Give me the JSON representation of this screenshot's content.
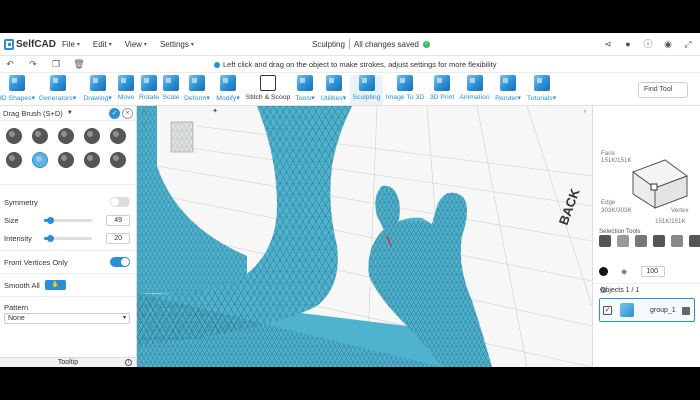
{
  "app": {
    "name": "SelfCAD",
    "mode": "Sculpting",
    "save_status": "All changes saved"
  },
  "menu": [
    {
      "label": "File"
    },
    {
      "label": "Edit"
    },
    {
      "label": "View"
    },
    {
      "label": "Settings"
    }
  ],
  "hint": "Left click and drag on the object to make strokes, adjust settings for more flexibility",
  "toolbar": {
    "tools": [
      {
        "label": "3D Shapes",
        "caret": true
      },
      {
        "label": "Generators",
        "caret": true
      },
      {
        "label": "Drawing",
        "caret": true
      },
      {
        "label": "Move",
        "caret": false
      },
      {
        "label": "Rotate",
        "caret": false
      },
      {
        "label": "Scale",
        "caret": false
      },
      {
        "label": "Deform",
        "caret": true
      },
      {
        "label": "Modify",
        "caret": true
      },
      {
        "label": "Stitch & Scoop",
        "caret": false
      },
      {
        "label": "Tools",
        "caret": true
      },
      {
        "label": "Utilities",
        "caret": true
      },
      {
        "label": "Sculpting",
        "caret": false
      },
      {
        "label": "Image To 3D",
        "caret": false
      },
      {
        "label": "3D Print",
        "caret": false
      },
      {
        "label": "Animation",
        "caret": false
      },
      {
        "label": "Render",
        "caret": true
      },
      {
        "label": "Tutorials",
        "caret": true
      }
    ],
    "find_tool": "Find Tool"
  },
  "left_panel": {
    "title": "Drag Brush (S+D)",
    "symmetry_label": "Symmetry",
    "size_label": "Size",
    "size_value": "49",
    "intensity_label": "Intensity",
    "intensity_value": "20",
    "front_vertices_label": "Front Vertices Only",
    "front_vertices_on": true,
    "symmetry_on": false,
    "smooth_all_label": "Smooth All",
    "pattern_label": "Pattern",
    "pattern_value": "None",
    "tooltip_label": "Tooltip"
  },
  "viewport": {
    "annotation": "BACK"
  },
  "right_panel": {
    "face_label": "Face",
    "face_count": "151K/151K",
    "edge_label": "Edge",
    "edge_count": "303K/303K",
    "vertex_label": "Vertex",
    "vertex_count": "151K/151K",
    "selection_tools_label": "Selection Tools",
    "opacity_value": "100",
    "objects_label": "Objects 1 / 1",
    "object_name": "group_1"
  },
  "colors": {
    "accent": "#2a8fd6",
    "mesh": "#4fb3cf",
    "mesh_edge": "#1f5f72"
  }
}
